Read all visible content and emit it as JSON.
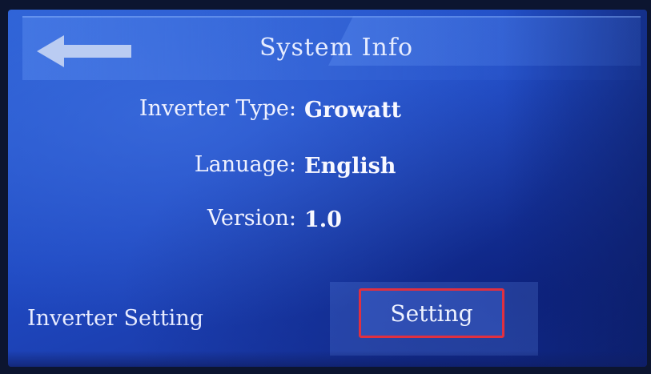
{
  "header": {
    "title": "System Info",
    "back_icon": "left-arrow-icon"
  },
  "info": {
    "inverter_type_label": "Inverter Type:",
    "inverter_type_value": "Growatt",
    "language_label": "Lanuage:",
    "language_value": "English",
    "version_label": "Version:",
    "version_value": "1.0"
  },
  "footer": {
    "inverter_setting_label": "Inverter Setting",
    "setting_button_label": "Setting"
  },
  "colors": {
    "screen_blue": "#1f49c2",
    "text": "#f0f2ff",
    "highlight_border": "#e03040"
  }
}
